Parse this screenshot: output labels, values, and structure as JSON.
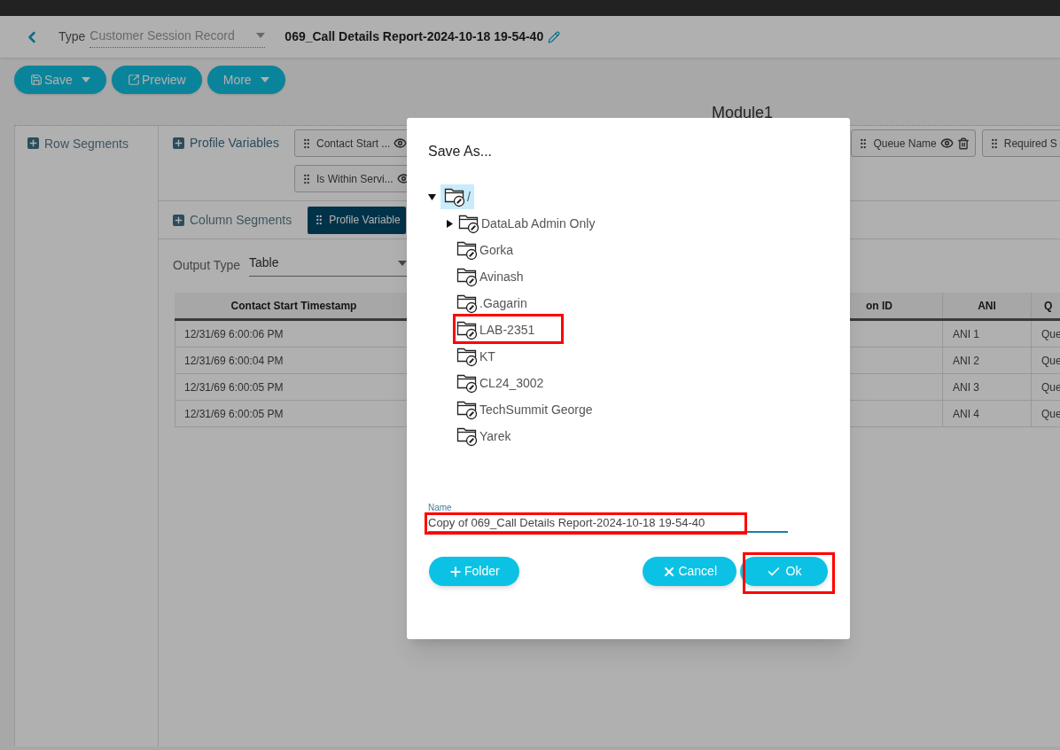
{
  "header": {
    "type_label": "Type",
    "type_value": "Customer Session Record",
    "report_title": "069_Call Details Report-2024-10-18 19-54-40"
  },
  "toolbar": [
    {
      "label": "Save",
      "kind": "save",
      "dropdown": true
    },
    {
      "label": "Preview",
      "kind": "preview",
      "dropdown": false
    },
    {
      "label": "More",
      "kind": "plain",
      "dropdown": true
    }
  ],
  "module_title": "Module1",
  "row_segments": {
    "label": "Row Segments"
  },
  "profile_variables": {
    "label": "Profile Variables",
    "chips": [
      {
        "label": "Contact Start ..."
      },
      {
        "label": "Queue Name"
      },
      {
        "label": "Required S"
      },
      {
        "label": "Is Within Servi..."
      }
    ]
  },
  "column_segments": {
    "label": "Column Segments",
    "chips": [
      {
        "label": "Profile Variable"
      }
    ]
  },
  "output_type": {
    "label": "Output Type",
    "value": "Table"
  },
  "table": {
    "columns": [
      "Contact Start Timestamp",
      "on ID",
      "ANI",
      "Q"
    ],
    "rows": [
      {
        "timestamp": "12/31/69 6:00:06 PM",
        "ani": "ANI 1",
        "queue": "Que"
      },
      {
        "timestamp": "12/31/69 6:00:04 PM",
        "ani": "ANI 2",
        "queue": "Que"
      },
      {
        "timestamp": "12/31/69 6:00:05 PM",
        "ani": "ANI 3",
        "queue": "Que"
      },
      {
        "timestamp": "12/31/69 6:00:05 PM",
        "ani": "ANI 4",
        "queue": "Que"
      }
    ]
  },
  "dialog": {
    "title": "Save As...",
    "tree": {
      "label": "/",
      "expanded": true,
      "selected": true,
      "children": [
        {
          "label": "DataLab Admin Only",
          "expanded": false,
          "has_children": true,
          "selected": false,
          "annotated": false
        },
        {
          "label": "Gorka",
          "has_children": false,
          "selected": false,
          "annotated": false
        },
        {
          "label": "Avinash",
          "has_children": false,
          "selected": false,
          "annotated": false
        },
        {
          "label": ".Gagarin",
          "has_children": false,
          "selected": false,
          "annotated": false
        },
        {
          "label": "LAB-2351",
          "has_children": false,
          "selected": false,
          "annotated": true
        },
        {
          "label": "KT",
          "has_children": false,
          "selected": false,
          "annotated": false
        },
        {
          "label": "CL24_3002",
          "has_children": false,
          "selected": false,
          "annotated": false
        },
        {
          "label": "TechSummit George",
          "has_children": false,
          "selected": false,
          "annotated": false
        },
        {
          "label": "Yarek",
          "has_children": false,
          "selected": false,
          "annotated": false
        }
      ]
    },
    "name_field": {
      "label": "Name",
      "value": "Copy of 069_Call Details Report-2024-10-18 19-54-40",
      "annotated": true
    },
    "buttons": [
      {
        "label": "Folder",
        "kind": "add",
        "annotated": false
      },
      {
        "label": "Cancel",
        "kind": "cancel",
        "annotated": false
      },
      {
        "label": "Ok",
        "kind": "ok",
        "annotated": true
      }
    ]
  }
}
